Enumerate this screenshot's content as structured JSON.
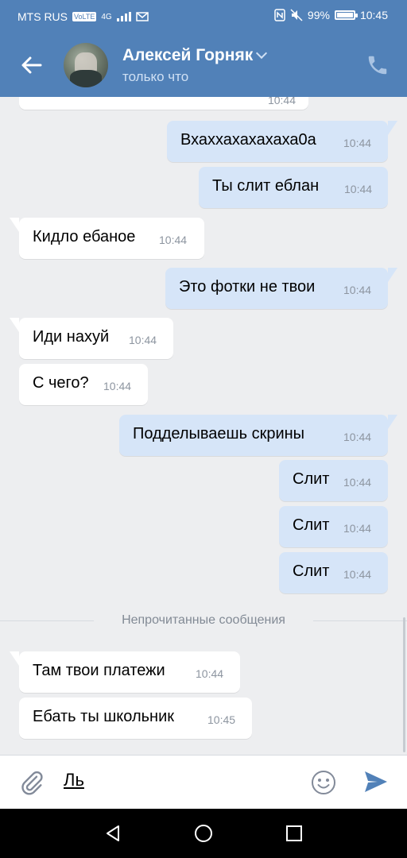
{
  "status_bar": {
    "carrier": "MTS RUS",
    "volte": "VoLTE",
    "network": "4G",
    "battery_text": "99%",
    "battery_level": 0.99,
    "time": "10:45"
  },
  "header": {
    "contact_name": "Алексей Горняк",
    "contact_status": "только что",
    "avatar_alt": "avatar"
  },
  "messages": [
    {
      "dir": "out",
      "text": "Вхаххахахахаха0а",
      "time": "10:44"
    },
    {
      "dir": "out",
      "text": "Ты слит еблан",
      "time": "10:44"
    },
    {
      "dir": "in",
      "text": "Кидло ебаное",
      "time": "10:44"
    },
    {
      "dir": "out",
      "text": "Это фотки не твои",
      "time": "10:44"
    },
    {
      "dir": "in",
      "text": "Иди нахуй",
      "time": "10:44"
    },
    {
      "dir": "in",
      "text": "С чего?",
      "time": "10:44"
    },
    {
      "dir": "out",
      "text": "Подделываешь скрины",
      "time": "10:44"
    },
    {
      "dir": "out",
      "text": "Слит",
      "time": "10:44"
    },
    {
      "dir": "out",
      "text": "Слит",
      "time": "10:44"
    },
    {
      "dir": "out",
      "text": "Слит",
      "time": "10:44"
    },
    {
      "dir": "in",
      "text": "Там твои платежи",
      "time": "10:44"
    },
    {
      "dir": "in",
      "text": "Ебать ты школьник",
      "time": "10:45"
    }
  ],
  "partial_top_message": {
    "time": "10:44"
  },
  "divider_text": "Непрочитанные сообщения",
  "composer": {
    "value": "Ль"
  },
  "colors": {
    "header": "#5181b8",
    "incoming_bubble": "#ffffff",
    "outgoing_bubble": "#d6e5f8",
    "background": "#edeef0",
    "send_icon": "#5181b8"
  },
  "icons": {
    "back": "back-arrow-icon",
    "call": "phone-icon",
    "attach": "paperclip-icon",
    "emoji": "smiley-icon",
    "send": "send-icon",
    "nav_back": "triangle-back-icon",
    "nav_home": "circle-home-icon",
    "nav_recent": "square-recent-icon"
  }
}
